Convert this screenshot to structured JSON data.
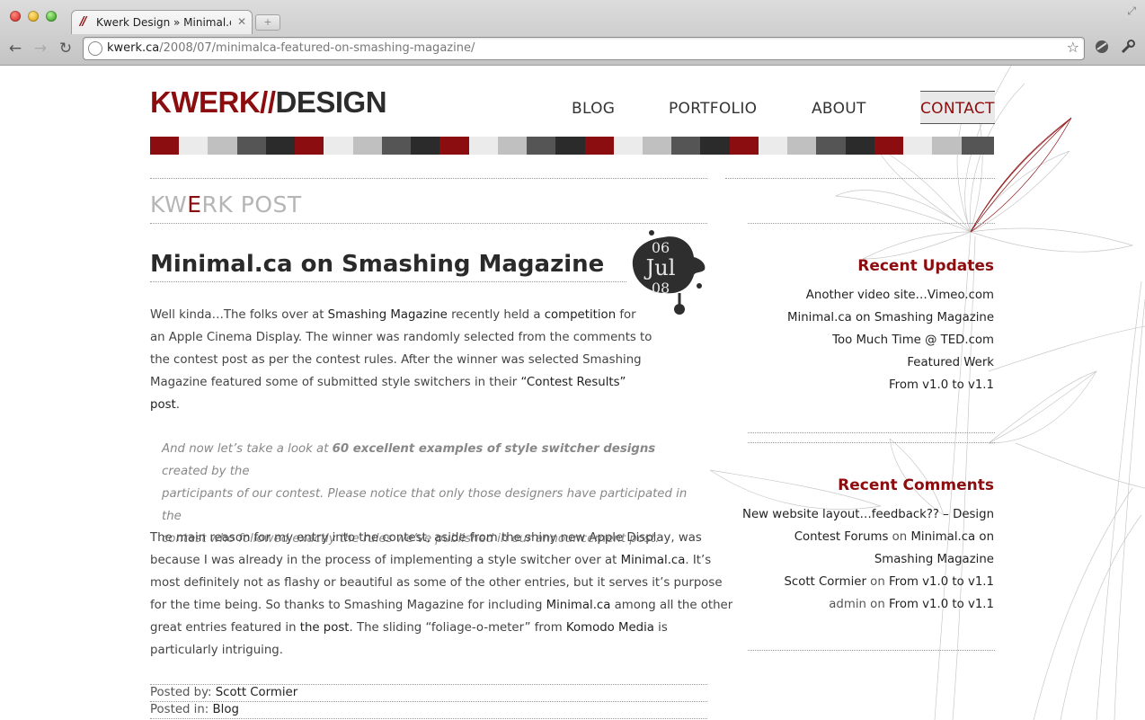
{
  "browser": {
    "tab_title": "Kwerk Design » Minimal.ca o",
    "tab_favicon": "//",
    "tab_close": "✕",
    "new_tab": "+",
    "url_domain": "kwerk.ca",
    "url_path": "/2008/07/minimalca-featured-on-smashing-magazine/",
    "back": "←",
    "forward": "→",
    "reload": "↻",
    "star": "☆",
    "resize": "⤢"
  },
  "site": {
    "logo_kwerk": "KWERK",
    "logo_slashes": "//",
    "logo_design": "DESIGN",
    "nav": {
      "blog": "BLOG",
      "portfolio": "PORTFOLIO",
      "about": "ABOUT",
      "contact": "CONTACT"
    },
    "colorbar": [
      "#8c0d0f",
      "#ebebeb",
      "#c0c0c0",
      "#555555",
      "#2b2b2b",
      "#8c0d0f",
      "#ebebeb",
      "#c0c0c0",
      "#555555",
      "#2b2b2b",
      "#8c0d0f",
      "#ebebeb",
      "#c0c0c0",
      "#555555",
      "#2b2b2b",
      "#8c0d0f",
      "#ebebeb",
      "#c0c0c0",
      "#555555",
      "#2b2b2b",
      "#8c0d0f",
      "#ebebeb",
      "#c0c0c0",
      "#555555",
      "#2b2b2b",
      "#8c0d0f",
      "#ebebeb",
      "#c0c0c0",
      "#555555"
    ]
  },
  "section": {
    "kw": "KW",
    "e": "E",
    "rk_post": "RK POST"
  },
  "post": {
    "title": "Minimal.ca on Smashing Magazine",
    "date_day": "06",
    "date_month": "Jul",
    "date_year": "08",
    "p1_a": "Well kinda…The folks over at ",
    "p1_link1": "Smashing Magazine",
    "p1_b": " recently held a ",
    "p1_link2": "competition",
    "p1_c": " for",
    "p1_line2": "an Apple Cinema Display. The winner was randomly selected from the comments to",
    "p1_line3": "the contest post as per the contest rules. After the winner was selected Smashing",
    "p1_line4a": "Magazine featured some of submitted style switchers in their ",
    "p1_link3": "“Contest Results”",
    "p1_line5": "post",
    "quote_a": "And now let’s take a look at ",
    "quote_b": "60 excellent examples of style switcher designs",
    "quote_c": " created by the",
    "quote_line2": "participants of our contest. Please notice that only those designers have participated in the",
    "quote_line3": "contest who followed exactly the rules we’ve published in our announcement post.",
    "p2_line1": "The main reason for my entry into the contest, aside from the shiny new Apple Display, was",
    "p2_line2a": "because I was already in the process of implementing a style switcher over at ",
    "p2_link1": "Minimal.ca",
    "p2_line2b": ". It’s",
    "p2_line3": "most definitely not as flashy or beautiful as some of the other entries, but it serves it’s purpose",
    "p2_line4a": "for the time being. So thanks to Smashing Magazine for including ",
    "p2_link2": "Minimal.ca",
    "p2_line4b": " among all the other",
    "p2_line5a": "great entries featured in ",
    "p2_link3": "the post",
    "p2_line5b": ". The sliding “foliage-o-meter” from ",
    "p2_link4": "Komodo Media",
    "p2_line5c": " is",
    "p2_line6": "particularly intriguing.",
    "posted_by_label": "Posted by: ",
    "posted_by": "Scott Cormier",
    "posted_in_label": "Posted in: ",
    "posted_in": "Blog"
  },
  "sidebar": {
    "recent_updates_title": "Recent Updates",
    "recent_updates": [
      "Another video site…Vimeo.com",
      "Minimal.ca on Smashing Magazine",
      "Too Much Time @ TED.com",
      "Featured Werk",
      "From v1.0 to v1.1"
    ],
    "recent_comments_title": "Recent Comments",
    "c1_author": "New website layout…feedback?? – Design",
    "c1_author2": "Contest Forums",
    "c1_on": " on ",
    "c1_post": "Minimal.ca on",
    "c1_post2": "Smashing Magazine",
    "c2_author": "Scott Cormier",
    "c2_on": " on ",
    "c2_post": "From v1.0 to v1.1",
    "c3_author": "admin",
    "c3_on": " on ",
    "c3_post": "From v1.0 to v1.1"
  }
}
